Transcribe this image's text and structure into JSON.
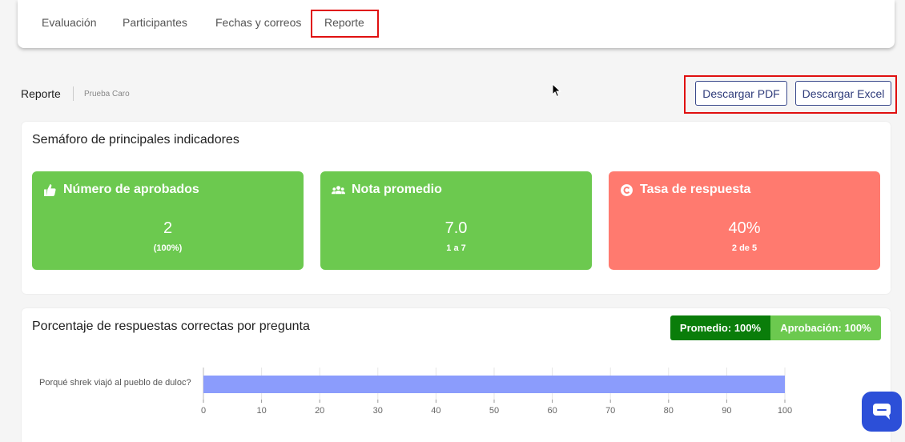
{
  "tabs": [
    {
      "label": "Evaluación"
    },
    {
      "label": "Participantes"
    },
    {
      "label": "Fechas y correos"
    },
    {
      "label": "Reporte"
    }
  ],
  "report": {
    "title": "Reporte",
    "subtitle": "Prueba Caro",
    "download_pdf": "Descargar PDF",
    "download_excel": "Descargar Excel"
  },
  "indicators_card": {
    "title": "Semáforo de principales indicadores",
    "items": [
      {
        "label": "Número de aprobados",
        "value": "2",
        "sub": "(100%)",
        "icon": "thumbs-up-icon",
        "color": "#6cc94f"
      },
      {
        "label": "Nota promedio",
        "value": "7.0",
        "sub": "1 a 7",
        "icon": "users-icon",
        "color": "#6cc94f"
      },
      {
        "label": "Tasa de respuesta",
        "value": "40%",
        "sub": "2 de 5",
        "icon": "copyright-icon",
        "color": "#ff7a6f"
      }
    ]
  },
  "chart_card": {
    "title": "Porcentaje de respuestas correctas por pregunta",
    "promedio": "Promedio: 100%",
    "aprobacion": "Aprobación: 100%",
    "promedio_color": "#0a7d0a",
    "aprobacion_color": "#6cc94f"
  },
  "chart_data": {
    "type": "bar",
    "orientation": "horizontal",
    "categories": [
      "Porqué shrek viajó al pueblo de duloc?"
    ],
    "values": [
      100
    ],
    "xlim": [
      0,
      100
    ],
    "xticks": [
      "0",
      "10",
      "20",
      "30",
      "40",
      "50",
      "60",
      "70",
      "80",
      "90",
      "100"
    ],
    "bar_color": "#8b9cfc",
    "grid": true
  },
  "colors": {
    "highlight": "#e01010",
    "button_border": "#3b4a8c",
    "chat_button": "#2c4fd8"
  }
}
